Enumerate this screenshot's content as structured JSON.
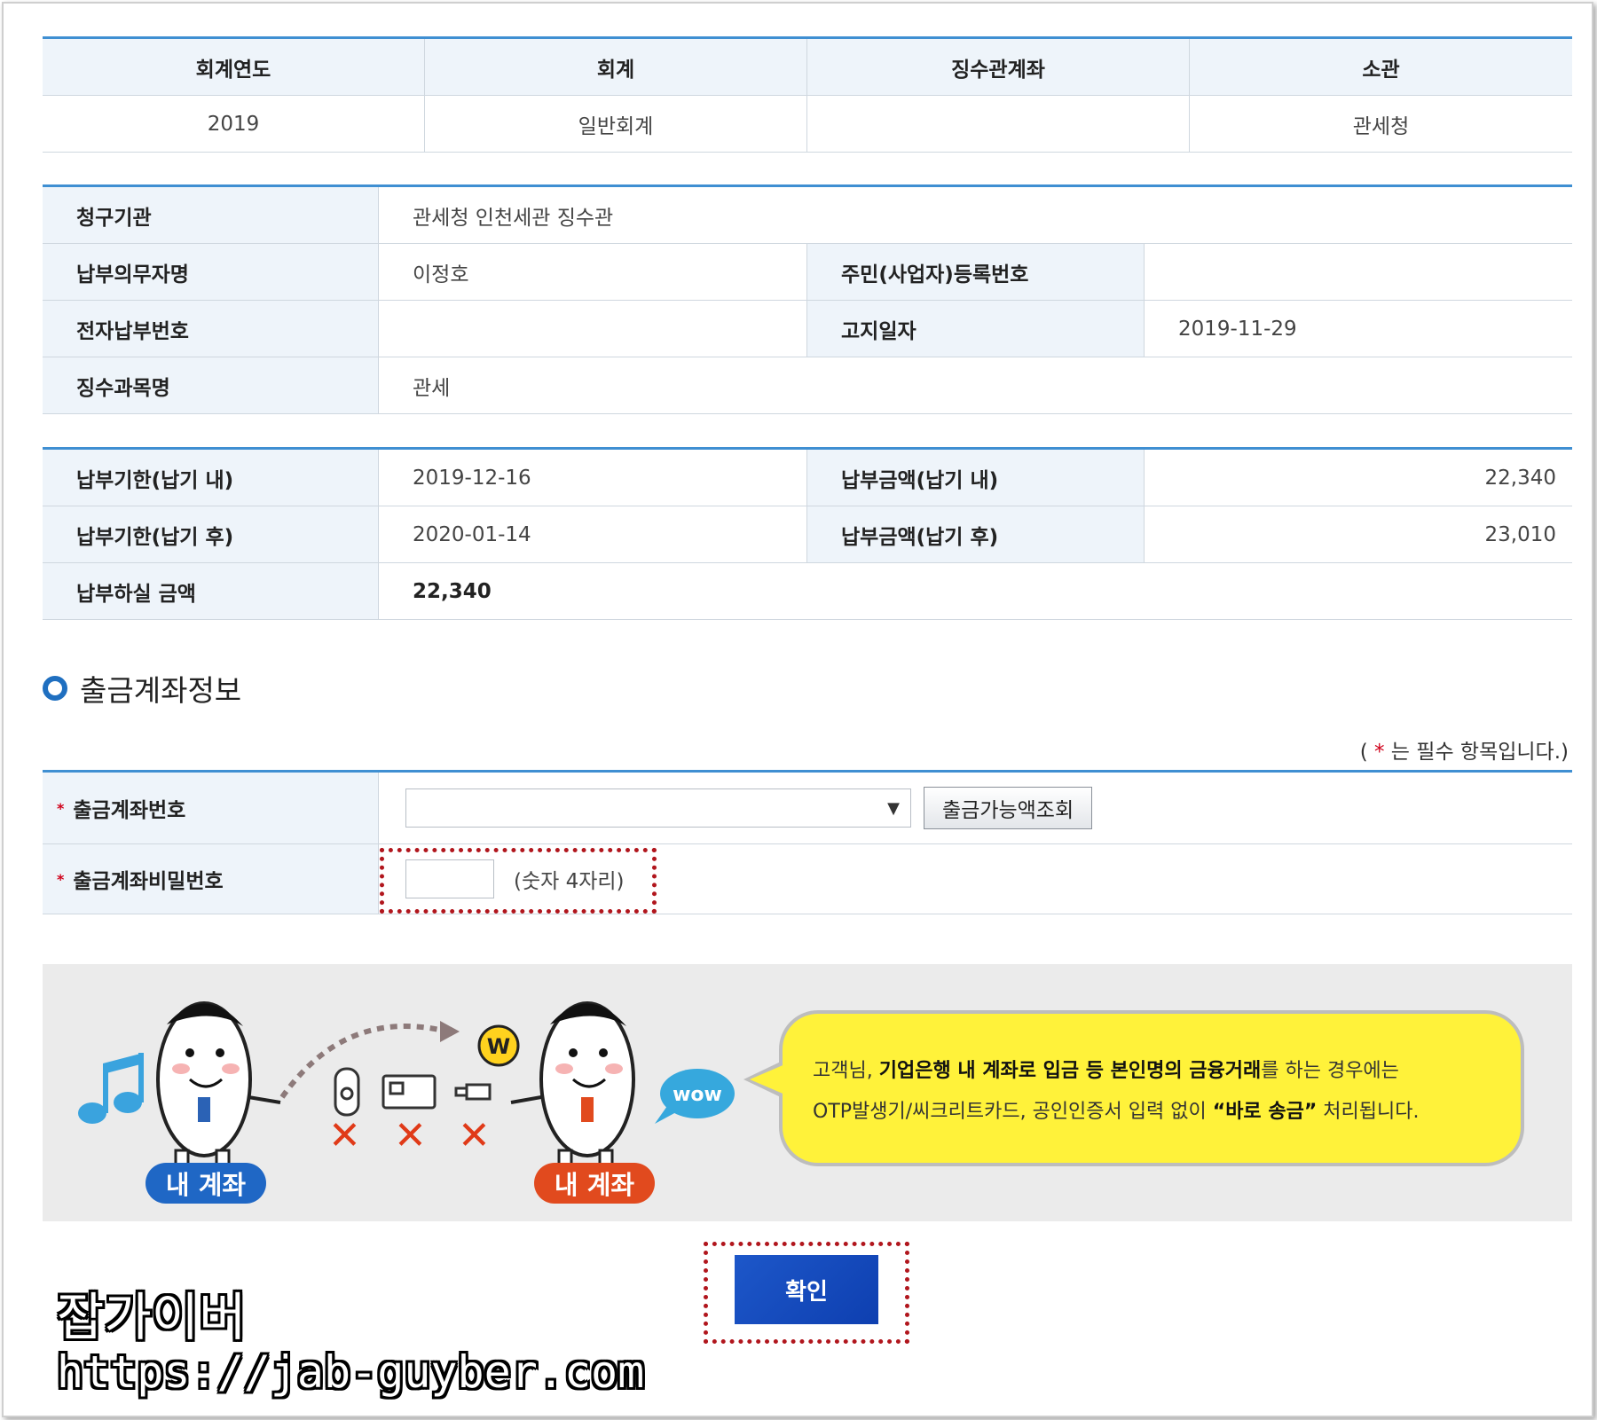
{
  "table1": {
    "headers": [
      "회계연도",
      "회계",
      "징수관계좌",
      "소관"
    ],
    "values": [
      "2019",
      "일반회계",
      "",
      "관세청"
    ]
  },
  "table2": {
    "claim_org_label": "청구기관",
    "claim_org_value": "관세청 인천세관 징수관",
    "payer_label": "납부의무자명",
    "payer_value": "이정호",
    "reg_no_label": "주민(사업자)등록번호",
    "reg_no_value": "",
    "e_pay_no_label": "전자납부번호",
    "e_pay_no_value": "",
    "notice_date_label": "고지일자",
    "notice_date_value": "2019-11-29",
    "subject_label": "징수과목명",
    "subject_value": "관세"
  },
  "table3": {
    "due_in_label": "납부기한(납기 내)",
    "due_in_value": "2019-12-16",
    "amount_in_label": "납부금액(납기 내)",
    "amount_in_value": "22,340",
    "due_after_label": "납부기한(납기 후)",
    "due_after_value": "2020-01-14",
    "amount_after_label": "납부금액(납기 후)",
    "amount_after_value": "23,010",
    "pay_amount_label": "납부하실 금액",
    "pay_amount_value": "22,340"
  },
  "section": {
    "title": "출금계좌정보",
    "required_prefix": "( ",
    "required_star": "*",
    "required_suffix": " 는 필수 항목입니다.)"
  },
  "form": {
    "account_label": "출금계좌번호",
    "account_select_value": "",
    "balance_button": "출금가능액조회",
    "password_label": "출금계좌비밀번호",
    "password_hint": "(숫자 4자리)",
    "star": "*"
  },
  "banner": {
    "left_badge": "내 계좌",
    "right_badge": "내 계좌",
    "wow": "wow",
    "coin": "W",
    "text_pre": "고객님, ",
    "text_bold1": "기업은행 내 계좌로 입금 등 본인명의 금융거래",
    "text_mid": "를 하는 경우에는",
    "text_line2_pre": "OTP발생기/씨크리트카드, 공인인증서 입력 없이 ",
    "text_bold2": "“바로 송금”",
    "text_end": " 처리됩니다."
  },
  "confirm_button": "확인",
  "watermark": {
    "title": "잡가이버",
    "url": "https://jab-guyber.com"
  },
  "colors": {
    "accent_blue": "#3f8fd2",
    "header_bg": "#eef4fa",
    "required_red": "#d0021b",
    "confirm_blue": "#1d57c9",
    "bubble_yellow": "#fff23a",
    "badge_blue": "#1f67c5",
    "badge_red": "#e14a1e"
  }
}
